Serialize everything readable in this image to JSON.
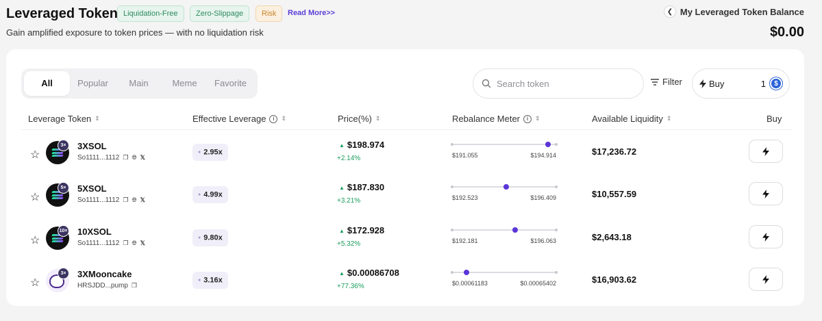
{
  "header": {
    "title": "Leveraged Token",
    "tags": [
      "Liquidation-Free",
      "Zero-Slippage",
      "Risk"
    ],
    "read_more": "Read More>>",
    "subtitle": "Gain amplified exposure to token prices — with no liquidation risk",
    "balance_label": "My Leveraged Token Balance",
    "balance_value": "$0.00"
  },
  "tabs": [
    "All",
    "Popular",
    "Main",
    "Meme",
    "Favorite"
  ],
  "active_tab": "All",
  "search": {
    "placeholder": "Search token"
  },
  "filter_label": "Filter",
  "buy_box": {
    "label": "Buy",
    "amount": "1"
  },
  "columns": [
    "Leverage Token",
    "Effective Leverage",
    "Price(%)",
    "Rebalance Meter",
    "Available Liquidity",
    "Buy"
  ],
  "rows": [
    {
      "name": "3XSOL",
      "address": "So1111...1112",
      "badge": "3×",
      "logo": "sol",
      "socials": true,
      "leverage": "2.95x",
      "price": "$198.974",
      "change": "+2.14%",
      "meter_low": "$191.055",
      "meter_high": "$194.914",
      "meter_fraction": 0.93,
      "liquidity": "$17,236.72"
    },
    {
      "name": "5XSOL",
      "address": "So1111...1112",
      "badge": "5×",
      "logo": "sol",
      "socials": true,
      "leverage": "4.99x",
      "price": "$187.830",
      "change": "+3.21%",
      "meter_low": "$192.523",
      "meter_high": "$196.409",
      "meter_fraction": 0.52,
      "liquidity": "$10,557.59"
    },
    {
      "name": "10XSOL",
      "address": "So1111...1112",
      "badge": "10×",
      "logo": "sol",
      "socials": true,
      "leverage": "9.80x",
      "price": "$172.928",
      "change": "+5.32%",
      "meter_low": "$192.181",
      "meter_high": "$196.063",
      "meter_fraction": 0.61,
      "liquidity": "$2,643.18"
    },
    {
      "name": "3XMooncake",
      "address": "HRSJDD...pump",
      "badge": "3×",
      "logo": "mooncake",
      "socials": false,
      "leverage": "3.16x",
      "price": "$0.00086708",
      "change": "+77.36%",
      "meter_low": "$0.00061183",
      "meter_high": "$0.00065402",
      "meter_fraction": 0.13,
      "liquidity": "$16,903.62"
    }
  ],
  "colors": {
    "accent": "#5a35d8",
    "positive": "#1a9b5b",
    "tag_green": "#2f8a5d",
    "tag_orange": "#c8812a"
  }
}
